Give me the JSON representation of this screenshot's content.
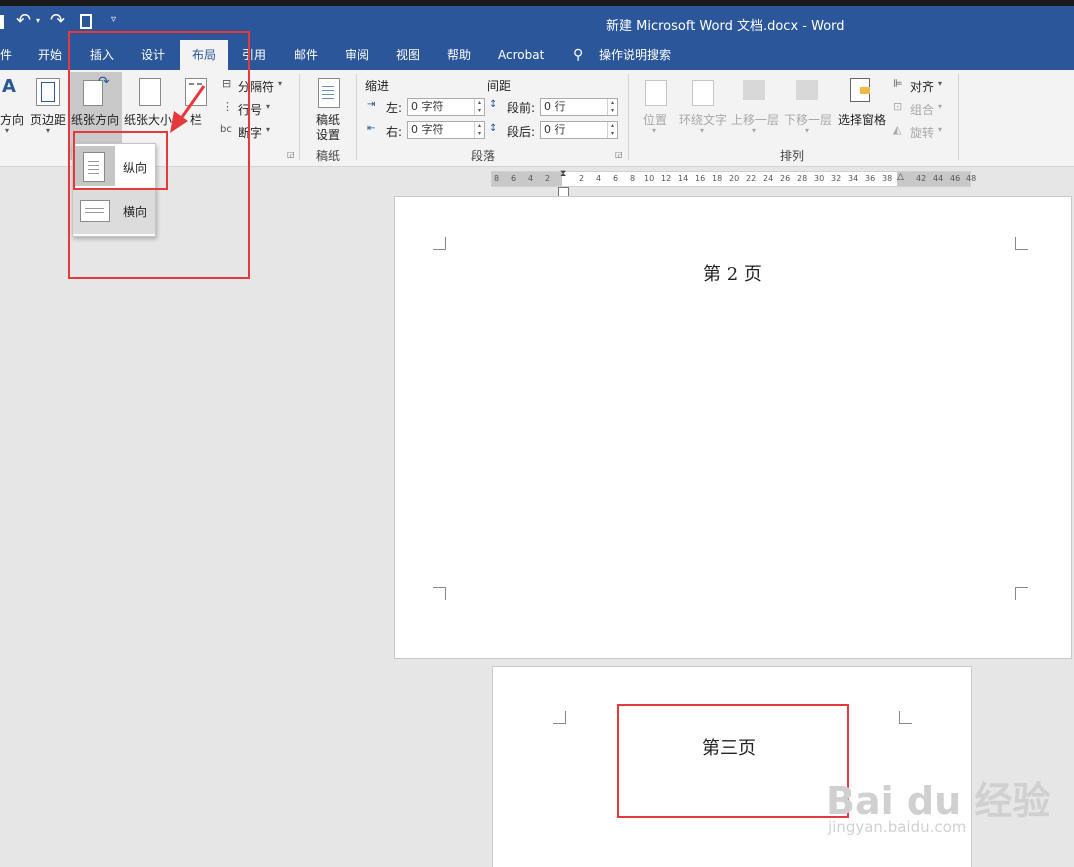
{
  "window": {
    "title": "新建 Microsoft Word 文档.docx  -  Word"
  },
  "tabs": [
    {
      "label": "件"
    },
    {
      "label": "开始"
    },
    {
      "label": "插入"
    },
    {
      "label": "设计"
    },
    {
      "label": "布局"
    },
    {
      "label": "引用"
    },
    {
      "label": "邮件"
    },
    {
      "label": "审阅"
    },
    {
      "label": "视图"
    },
    {
      "label": "帮助"
    },
    {
      "label": "Acrobat"
    },
    {
      "label": "操作说明搜索"
    }
  ],
  "ribbon": {
    "page_setup": {
      "direction": "方向",
      "margins": "页边距",
      "orientation": "纸张方向",
      "size": "纸张大小",
      "columns": "栏",
      "breaks": "分隔符",
      "line_numbers": "行号",
      "hyphenation": "断字"
    },
    "manuscript": {
      "settings_line1": "稿纸",
      "settings_line2": "设置",
      "group": "稿纸"
    },
    "paragraph": {
      "indent": "缩进",
      "spacing": "间距",
      "left_label": "左:",
      "left_value": "0 字符",
      "right_label": "右:",
      "right_value": "0 字符",
      "before_label": "段前:",
      "before_value": "0 行",
      "after_label": "段后:",
      "after_value": "0 行",
      "group": "段落"
    },
    "arrange": {
      "position": "位置",
      "wrap_text": "环绕文字",
      "bring_forward": "上移一层",
      "send_backward": "下移一层",
      "selection_pane": "选择窗格",
      "align": "对齐",
      "group_btn": "组合",
      "rotate": "旋转",
      "group": "排列"
    }
  },
  "orientation_menu": {
    "portrait": "纵向",
    "landscape": "横向"
  },
  "ruler": {
    "left_ticks": [
      "8",
      "6",
      "4",
      "2"
    ],
    "right_ticks": [
      "2",
      "4",
      "6",
      "8",
      "10",
      "12",
      "14",
      "16",
      "18",
      "20",
      "22",
      "24",
      "26",
      "28",
      "30",
      "32",
      "34",
      "36",
      "38",
      "42",
      "44",
      "46",
      "48"
    ]
  },
  "pages": {
    "page2_text": "第 2 页",
    "page3_text": "第三页"
  },
  "watermark": {
    "logo": "Bai du 经验",
    "url": "jingyan.baidu.com"
  },
  "colors": {
    "titlebar": "#2b579a",
    "highlight": "#e8393a",
    "ribbon": "#f3f3f3"
  }
}
